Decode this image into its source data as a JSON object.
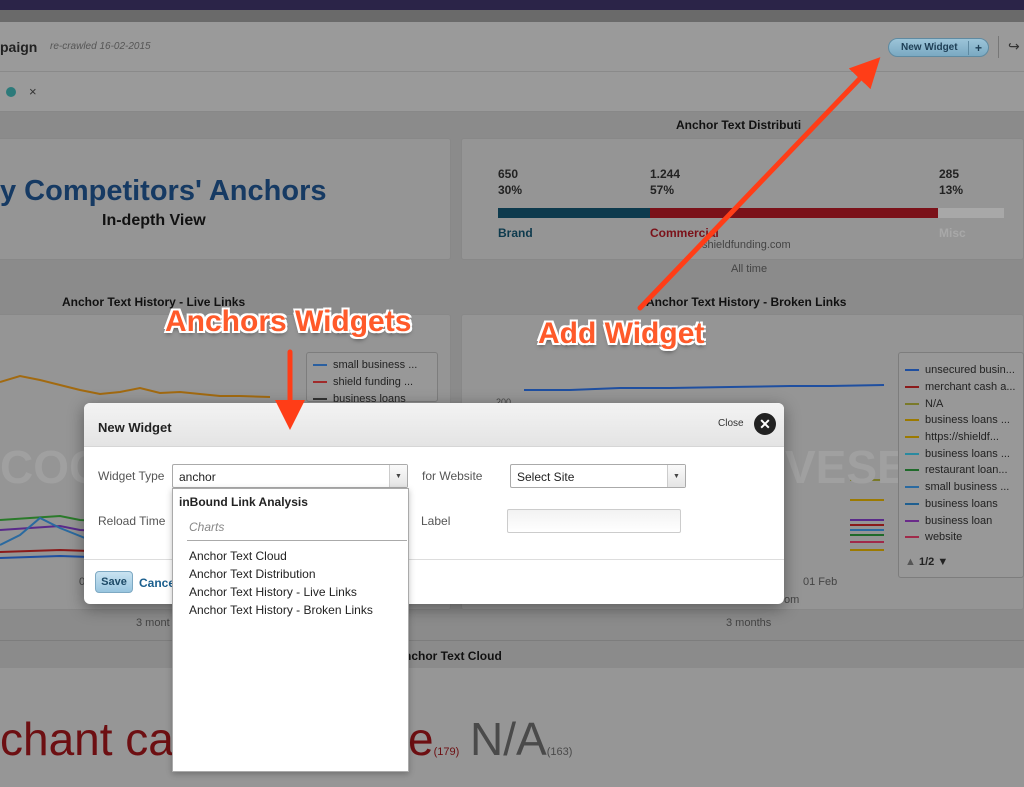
{
  "header": {
    "campaign_title": "paign",
    "recrawled": "re-crawled 16-02-2015",
    "new_widget_label": "New Widget",
    "new_widget_plus": "+",
    "export_icon": "export-icon"
  },
  "filter": {
    "close": "×"
  },
  "panels": {
    "anchor_dist_title": "Anchor Text Distributi",
    "competitors_title": "y Competitors' Anchors",
    "competitors_sub": "In-depth View",
    "distribution": [
      {
        "count": "650",
        "pct": "30%",
        "label": "Brand",
        "color": "#0d3a4d",
        "share": 0.3
      },
      {
        "count": "1.244",
        "pct": "57%",
        "label": "Commercial",
        "color": "#7b1119",
        "share": 0.57
      },
      {
        "count": "285",
        "pct": "13%",
        "label": "Misc",
        "color": "#a8a8a8",
        "share": 0.13
      }
    ],
    "dist_site": "shieldfunding.com",
    "dist_time": "All time",
    "live_title": "Anchor Text History - Live Links",
    "broken_title": "Anchor Text History - Broken Links",
    "live_axis_left": "0",
    "live_time": "3 mont",
    "broken_axis_date": "01 Feb",
    "broken_axis_site": "om",
    "broken_time": "3 months",
    "broken_ytick": "200",
    "cloud_title": "nchor Text Cloud",
    "watermark_left": "COG",
    "watermark_right": "VESE"
  },
  "live_legend": [
    {
      "label": "small business ...",
      "color": "#2a5fa0"
    },
    {
      "label": "shield funding ...",
      "color": "#a02a2a"
    },
    {
      "label": "business loans",
      "color": "#333333"
    }
  ],
  "broken_legend": {
    "items": [
      {
        "label": "unsecured busin...",
        "color": "#1f4fa0"
      },
      {
        "label": "merchant cash a...",
        "color": "#8b1a1a"
      },
      {
        "label": "N/A",
        "color": "#7a7a2a"
      },
      {
        "label": "business loans ...",
        "color": "#9c7a00"
      },
      {
        "label": "https://shieldf...",
        "color": "#9c7a00"
      },
      {
        "label": "business loans ...",
        "color": "#2a8aa0"
      },
      {
        "label": "restaurant loan...",
        "color": "#1f6a2a"
      },
      {
        "label": "small business ...",
        "color": "#2a6aa0"
      },
      {
        "label": "business loans",
        "color": "#1f5f90"
      },
      {
        "label": "business loan",
        "color": "#6a2a8a"
      },
      {
        "label": "website",
        "color": "#a02a4a"
      }
    ],
    "pager": "1/2"
  },
  "annotations": {
    "anchors_widgets": "Anchors Widgets",
    "add_widget": "Add Widget"
  },
  "cloud": {
    "word1": "chant ca",
    "word2": "e",
    "word2_count": "(179)",
    "word3": "N/A",
    "word3_count": "(163)"
  },
  "modal": {
    "title": "New Widget",
    "close_text": "Close",
    "widget_type_label": "Widget Type",
    "widget_type_value": "anchor",
    "for_website_label": "for Website",
    "site_select_value": "Select Site",
    "reload_time_label": "Reload Time",
    "label_label": "Label",
    "save": "Save",
    "cancel": "Cance"
  },
  "dropdown": {
    "group": "inBound Link Analysis",
    "subgroup": "Charts",
    "items": [
      "Anchor Text Cloud",
      "Anchor Text Distribution",
      "Anchor Text History - Live Links",
      "Anchor Text History - Broken Links"
    ]
  },
  "colors": {
    "annotation": "#ff5a2a",
    "title_blue": "#163a63",
    "overlay_bg": "#8b8b8b"
  }
}
